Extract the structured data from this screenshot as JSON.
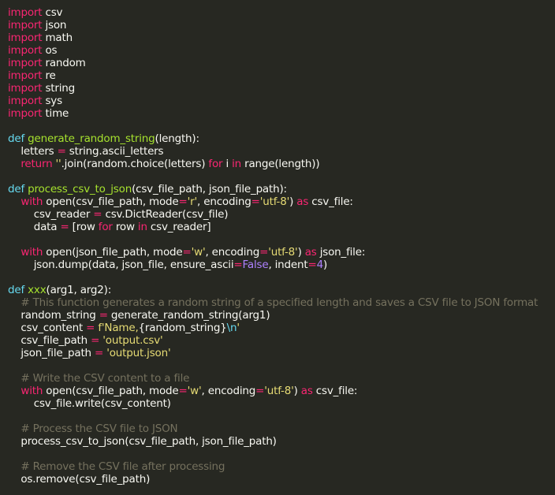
{
  "editor": {
    "theme_colors": {
      "background": "#272822",
      "plain": "#f8f8f2",
      "keyword": "#f92672",
      "function": "#a6e22e",
      "string": "#e6db74",
      "number": "#ae81ff",
      "builtin": "#66d9ef",
      "comment": "#75715e"
    },
    "lines": [
      [
        {
          "t": "kw",
          "v": "import"
        },
        {
          "t": "plain",
          "v": " csv"
        }
      ],
      [
        {
          "t": "kw",
          "v": "import"
        },
        {
          "t": "plain",
          "v": " json"
        }
      ],
      [
        {
          "t": "kw",
          "v": "import"
        },
        {
          "t": "plain",
          "v": " math"
        }
      ],
      [
        {
          "t": "kw",
          "v": "import"
        },
        {
          "t": "plain",
          "v": " os"
        }
      ],
      [
        {
          "t": "kw",
          "v": "import"
        },
        {
          "t": "plain",
          "v": " random"
        }
      ],
      [
        {
          "t": "kw",
          "v": "import"
        },
        {
          "t": "plain",
          "v": " re"
        }
      ],
      [
        {
          "t": "kw",
          "v": "import"
        },
        {
          "t": "plain",
          "v": " string"
        }
      ],
      [
        {
          "t": "kw",
          "v": "import"
        },
        {
          "t": "plain",
          "v": " sys"
        }
      ],
      [
        {
          "t": "kw",
          "v": "import"
        },
        {
          "t": "plain",
          "v": " time"
        }
      ],
      [],
      [
        {
          "t": "builtin",
          "v": "def"
        },
        {
          "t": "plain",
          "v": " "
        },
        {
          "t": "fn",
          "v": "generate_random_string"
        },
        {
          "t": "plain",
          "v": "(length):"
        }
      ],
      [
        {
          "t": "plain",
          "v": "    letters "
        },
        {
          "t": "kw",
          "v": "="
        },
        {
          "t": "plain",
          "v": " string.ascii_letters"
        }
      ],
      [
        {
          "t": "plain",
          "v": "    "
        },
        {
          "t": "kw",
          "v": "return"
        },
        {
          "t": "plain",
          "v": " "
        },
        {
          "t": "str",
          "v": "''"
        },
        {
          "t": "plain",
          "v": ".join(random.choice(letters) "
        },
        {
          "t": "kw",
          "v": "for"
        },
        {
          "t": "plain",
          "v": " i "
        },
        {
          "t": "kw",
          "v": "in"
        },
        {
          "t": "plain",
          "v": " range(length))"
        }
      ],
      [],
      [
        {
          "t": "builtin",
          "v": "def"
        },
        {
          "t": "plain",
          "v": " "
        },
        {
          "t": "fn",
          "v": "process_csv_to_json"
        },
        {
          "t": "plain",
          "v": "(csv_file_path, json_file_path):"
        }
      ],
      [
        {
          "t": "plain",
          "v": "    "
        },
        {
          "t": "kw",
          "v": "with"
        },
        {
          "t": "plain",
          "v": " open(csv_file_path, mode"
        },
        {
          "t": "kw",
          "v": "="
        },
        {
          "t": "str",
          "v": "'r'"
        },
        {
          "t": "plain",
          "v": ", encoding"
        },
        {
          "t": "kw",
          "v": "="
        },
        {
          "t": "str",
          "v": "'utf-8'"
        },
        {
          "t": "plain",
          "v": ") "
        },
        {
          "t": "kw",
          "v": "as"
        },
        {
          "t": "plain",
          "v": " csv_file:"
        }
      ],
      [
        {
          "t": "plain",
          "v": "        csv_reader "
        },
        {
          "t": "kw",
          "v": "="
        },
        {
          "t": "plain",
          "v": " csv.DictReader(csv_file)"
        }
      ],
      [
        {
          "t": "plain",
          "v": "        data "
        },
        {
          "t": "kw",
          "v": "="
        },
        {
          "t": "plain",
          "v": " [row "
        },
        {
          "t": "kw",
          "v": "for"
        },
        {
          "t": "plain",
          "v": " row "
        },
        {
          "t": "kw",
          "v": "in"
        },
        {
          "t": "plain",
          "v": " csv_reader]"
        }
      ],
      [],
      [
        {
          "t": "plain",
          "v": "    "
        },
        {
          "t": "kw",
          "v": "with"
        },
        {
          "t": "plain",
          "v": " open(json_file_path, mode"
        },
        {
          "t": "kw",
          "v": "="
        },
        {
          "t": "str",
          "v": "'w'"
        },
        {
          "t": "plain",
          "v": ", encoding"
        },
        {
          "t": "kw",
          "v": "="
        },
        {
          "t": "str",
          "v": "'utf-8'"
        },
        {
          "t": "plain",
          "v": ") "
        },
        {
          "t": "kw",
          "v": "as"
        },
        {
          "t": "plain",
          "v": " json_file:"
        }
      ],
      [
        {
          "t": "plain",
          "v": "        json.dump(data, json_file, ensure_ascii"
        },
        {
          "t": "kw",
          "v": "="
        },
        {
          "t": "num",
          "v": "False"
        },
        {
          "t": "plain",
          "v": ", indent"
        },
        {
          "t": "kw",
          "v": "="
        },
        {
          "t": "num",
          "v": "4"
        },
        {
          "t": "plain",
          "v": ")"
        }
      ],
      [],
      [
        {
          "t": "builtin",
          "v": "def"
        },
        {
          "t": "plain",
          "v": " "
        },
        {
          "t": "fn",
          "v": "xxx"
        },
        {
          "t": "plain",
          "v": "(arg1, arg2):"
        }
      ],
      [
        {
          "t": "plain",
          "v": "    "
        },
        {
          "t": "cm",
          "v": "# This function generates a random string of a specified length and saves a CSV file to JSON format"
        }
      ],
      [
        {
          "t": "plain",
          "v": "    random_string "
        },
        {
          "t": "kw",
          "v": "="
        },
        {
          "t": "plain",
          "v": " generate_random_string(arg1)"
        }
      ],
      [
        {
          "t": "plain",
          "v": "    csv_content "
        },
        {
          "t": "kw",
          "v": "="
        },
        {
          "t": "plain",
          "v": " "
        },
        {
          "t": "str",
          "v": "f'Name,"
        },
        {
          "t": "plain",
          "v": "{random_string}"
        },
        {
          "t": "builtin",
          "v": "\\n"
        },
        {
          "t": "str",
          "v": "'"
        }
      ],
      [
        {
          "t": "plain",
          "v": "    csv_file_path "
        },
        {
          "t": "kw",
          "v": "="
        },
        {
          "t": "plain",
          "v": " "
        },
        {
          "t": "str",
          "v": "'output.csv'"
        }
      ],
      [
        {
          "t": "plain",
          "v": "    json_file_path "
        },
        {
          "t": "kw",
          "v": "="
        },
        {
          "t": "plain",
          "v": " "
        },
        {
          "t": "str",
          "v": "'output.json'"
        }
      ],
      [],
      [
        {
          "t": "plain",
          "v": "    "
        },
        {
          "t": "cm",
          "v": "# Write the CSV content to a file"
        }
      ],
      [
        {
          "t": "plain",
          "v": "    "
        },
        {
          "t": "kw",
          "v": "with"
        },
        {
          "t": "plain",
          "v": " open(csv_file_path, mode"
        },
        {
          "t": "kw",
          "v": "="
        },
        {
          "t": "str",
          "v": "'w'"
        },
        {
          "t": "plain",
          "v": ", encoding"
        },
        {
          "t": "kw",
          "v": "="
        },
        {
          "t": "str",
          "v": "'utf-8'"
        },
        {
          "t": "plain",
          "v": ") "
        },
        {
          "t": "kw",
          "v": "as"
        },
        {
          "t": "plain",
          "v": " csv_file:"
        }
      ],
      [
        {
          "t": "plain",
          "v": "        csv_file.write(csv_content)"
        }
      ],
      [],
      [
        {
          "t": "plain",
          "v": "    "
        },
        {
          "t": "cm",
          "v": "# Process the CSV file to JSON"
        }
      ],
      [
        {
          "t": "plain",
          "v": "    process_csv_to_json(csv_file_path, json_file_path)"
        }
      ],
      [],
      [
        {
          "t": "plain",
          "v": "    "
        },
        {
          "t": "cm",
          "v": "# Remove the CSV file after processing"
        }
      ],
      [
        {
          "t": "plain",
          "v": "    os.remove(csv_file_path)"
        }
      ]
    ]
  }
}
